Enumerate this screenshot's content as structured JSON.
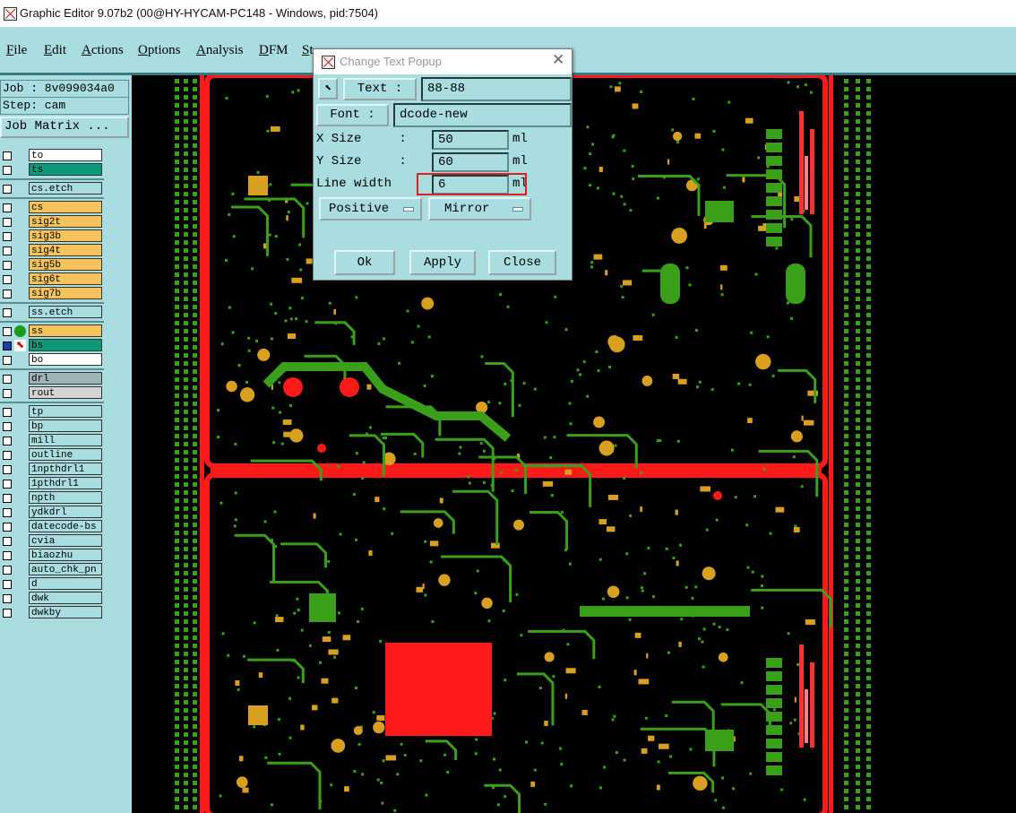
{
  "window": {
    "title": "Graphic Editor 9.07b2 (00@HY-HYCAM-PC148 - Windows, pid:7504)"
  },
  "menu": [
    "File",
    "Edit",
    "Actions",
    "Options",
    "Analysis",
    "DFM",
    "St"
  ],
  "job": {
    "job_label": "Job : 8v099034a0",
    "step_label": "Step: cam",
    "matrix_button": "Job Matrix ..."
  },
  "layers": [
    {
      "name": "to",
      "color": "#ffffff"
    },
    {
      "name": "ts",
      "color": "#0a9a7a"
    },
    {
      "name": "cs.etch",
      "color": "#a9dde0"
    },
    {
      "name": "cs",
      "color": "#f7c35a"
    },
    {
      "name": "sig2t",
      "color": "#f7c35a"
    },
    {
      "name": "sig3b",
      "color": "#f7c35a"
    },
    {
      "name": "sig4t",
      "color": "#f7c35a"
    },
    {
      "name": "sig5b",
      "color": "#f7c35a"
    },
    {
      "name": "sig6t",
      "color": "#f7c35a"
    },
    {
      "name": "sig7b",
      "color": "#f7c35a"
    },
    {
      "name": "ss.etch",
      "color": "#a9dde0"
    },
    {
      "name": "ss",
      "color": "#f7c35a"
    },
    {
      "name": "bs",
      "color": "#0a9a7a"
    },
    {
      "name": "bo",
      "color": "#ffffff"
    },
    {
      "name": "drl",
      "color": "#9fb3b5"
    },
    {
      "name": "rout",
      "color": "#d4d4d4"
    },
    {
      "name": "tp",
      "color": "#a9dde0"
    },
    {
      "name": "bp",
      "color": "#a9dde0"
    },
    {
      "name": "mill",
      "color": "#a9dde0"
    },
    {
      "name": "outline",
      "color": "#a9dde0"
    },
    {
      "name": "1npthdrl1",
      "color": "#a9dde0"
    },
    {
      "name": "1pthdrl1",
      "color": "#a9dde0"
    },
    {
      "name": "npth",
      "color": "#a9dde0"
    },
    {
      "name": "ydkdrl",
      "color": "#a9dde0"
    },
    {
      "name": "datecode-bs",
      "color": "#a9dde0"
    },
    {
      "name": "cvia",
      "color": "#a9dde0"
    },
    {
      "name": "biaozhu",
      "color": "#a9dde0"
    },
    {
      "name": "auto_chk_pn",
      "color": "#a9dde0"
    },
    {
      "name": "d",
      "color": "#a9dde0"
    },
    {
      "name": "dwk",
      "color": "#a9dde0"
    },
    {
      "name": "dwkby",
      "color": "#a9dde0"
    }
  ],
  "popup": {
    "title": "Change Text Popup",
    "text_button": "Text :",
    "text_value": "88-88",
    "font_button": "Font :",
    "font_value": "dcode-new",
    "x_size_label": "X Size     :",
    "x_size_value": "50",
    "y_size_label": "Y Size     :",
    "y_size_value": "60",
    "line_width_label": "Line width",
    "line_width_value": "6",
    "unit": "ml",
    "polarity": "Positive",
    "mirror": "Mirror",
    "ok": "Ok",
    "apply": "Apply",
    "close": "Close"
  },
  "colors": {
    "panel": "#a9dde0",
    "copper": "#3aa01a",
    "pad": "#d9a020",
    "outline": "#ff1a1a",
    "highlight": "#e02020"
  }
}
